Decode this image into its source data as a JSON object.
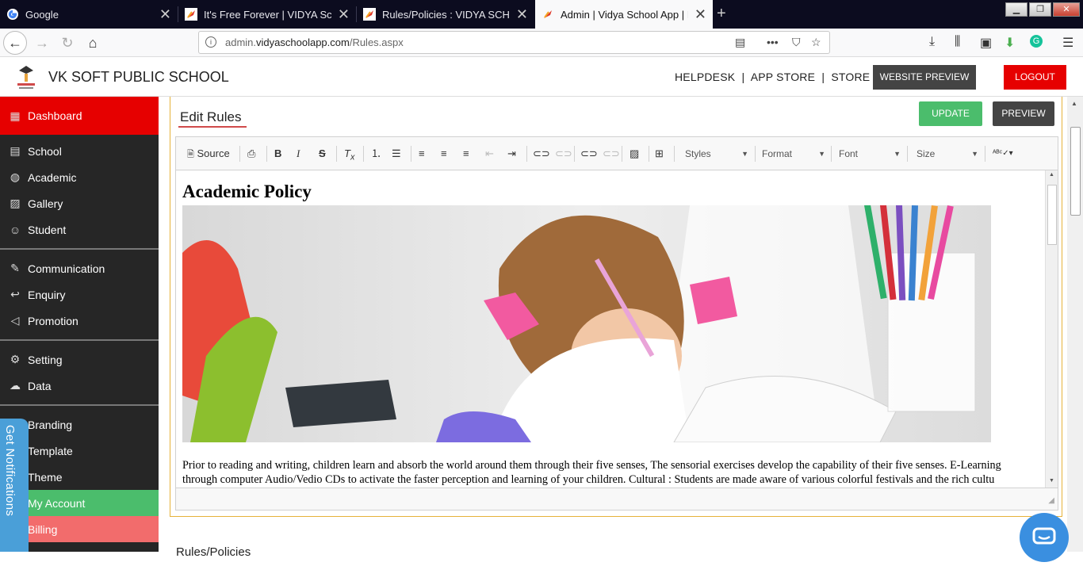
{
  "browser": {
    "tabs": [
      {
        "title": "Google",
        "active": false,
        "icon": "google-icon"
      },
      {
        "title": "It's Free Forever | VIDYA School",
        "active": false,
        "icon": "vidya-icon"
      },
      {
        "title": "Rules/Policies : VIDYA SCHOOL",
        "active": false,
        "icon": "vidya-icon"
      },
      {
        "title": "Admin | Vidya School App | It's",
        "active": true,
        "icon": "vidya-icon"
      }
    ],
    "url_prefix": "admin.",
    "url_domain": "vidyaschoolapp.com",
    "url_path": "/Rules.aspx"
  },
  "header": {
    "school_name": "VK SOFT PUBLIC SCHOOL",
    "links": "HELPDESK  |  APP STORE  |  STORE",
    "website_preview": "WEBSITE PREVIEW",
    "logout": "LOGOUT"
  },
  "sidebar": {
    "dashboard": "Dashboard",
    "items": [
      {
        "label": "School",
        "icon": "school-icon"
      },
      {
        "label": "Academic",
        "icon": "globe-icon"
      },
      {
        "label": "Gallery",
        "icon": "image-icon"
      },
      {
        "label": "Student",
        "icon": "student-icon"
      },
      {
        "label": "Communication",
        "icon": "communication-icon"
      },
      {
        "label": "Enquiry",
        "icon": "reply-icon"
      },
      {
        "label": "Promotion",
        "icon": "megaphone-icon"
      },
      {
        "label": "Setting",
        "icon": "gear-icon"
      },
      {
        "label": "Data",
        "icon": "cloud-icon"
      },
      {
        "label": "Branding",
        "icon": "branding-icon"
      },
      {
        "label": "Template",
        "icon": "template-icon"
      },
      {
        "label": "Theme",
        "icon": "theme-icon"
      },
      {
        "label": "My Account",
        "icon": "account-icon"
      },
      {
        "label": "Billing",
        "icon": "billing-icon"
      }
    ],
    "notifications": "Get Notifications"
  },
  "editor_panel": {
    "title": "Edit Rules",
    "update": "UPDATE",
    "preview": "PREVIEW",
    "toolbar": {
      "source": "Source",
      "styles": "Styles",
      "format": "Format",
      "font": "Font",
      "size": "Size"
    },
    "content": {
      "heading": "Academic Policy",
      "paragraph": "Prior to reading and writing, children learn and absorb the world around them through their five senses, The sensorial exercises develop the capability of their five senses. E-Learning through computer Audio/Vedio CDs to activate the faster perception and learning of your children. Cultural : Students are made aware of various colorful festivals and the rich cultu"
    }
  },
  "below_title": "Rules/Policies",
  "colors": {
    "sidebar_bg": "#262626",
    "brand_red": "#e60000",
    "green": "#4bbd6c",
    "pink": "#f26c6c",
    "panel_border": "#e6b23a",
    "notif_blue": "#4a9fd8"
  }
}
